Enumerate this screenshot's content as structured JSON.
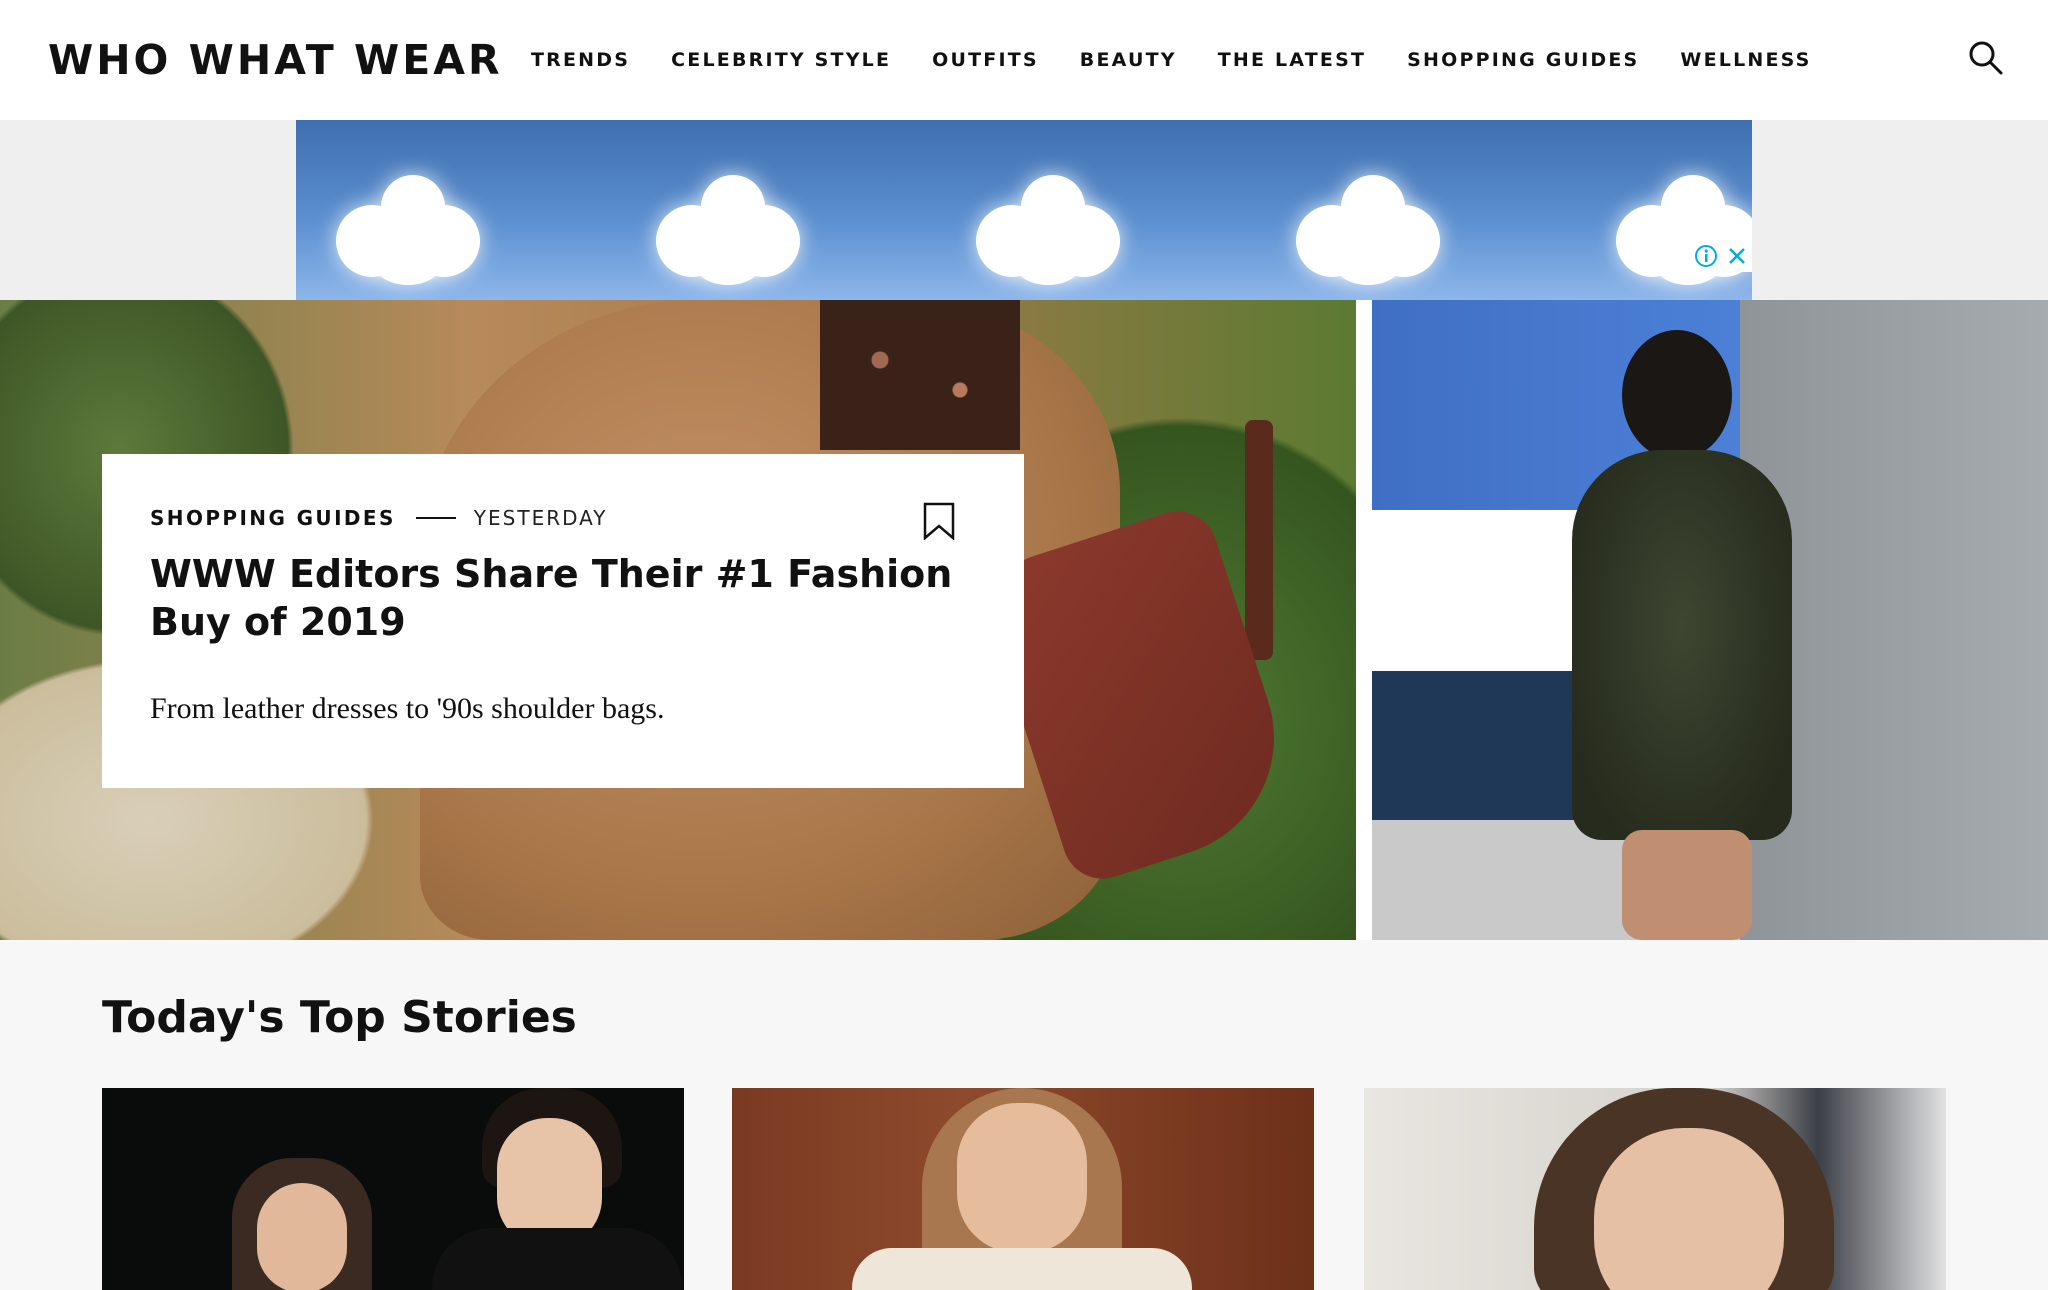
{
  "header": {
    "logo": "WHO WHAT WEAR",
    "nav": [
      "TRENDS",
      "CELEBRITY STYLE",
      "OUTFITS",
      "BEAUTY",
      "THE LATEST",
      "SHOPPING GUIDES",
      "WELLNESS"
    ],
    "search_icon": "search-icon"
  },
  "ad": {
    "info_icon": "info-icon",
    "close_icon": "close-icon"
  },
  "hero": {
    "category": "SHOPPING GUIDES",
    "date": "YESTERDAY",
    "title": "WWW Editors Share Their #1 Fashion Buy of 2019",
    "dek": "From leather dresses to '90s shoulder bags.",
    "bookmark_icon": "bookmark-icon"
  },
  "top_stories": {
    "title": "Today's Top Stories"
  }
}
